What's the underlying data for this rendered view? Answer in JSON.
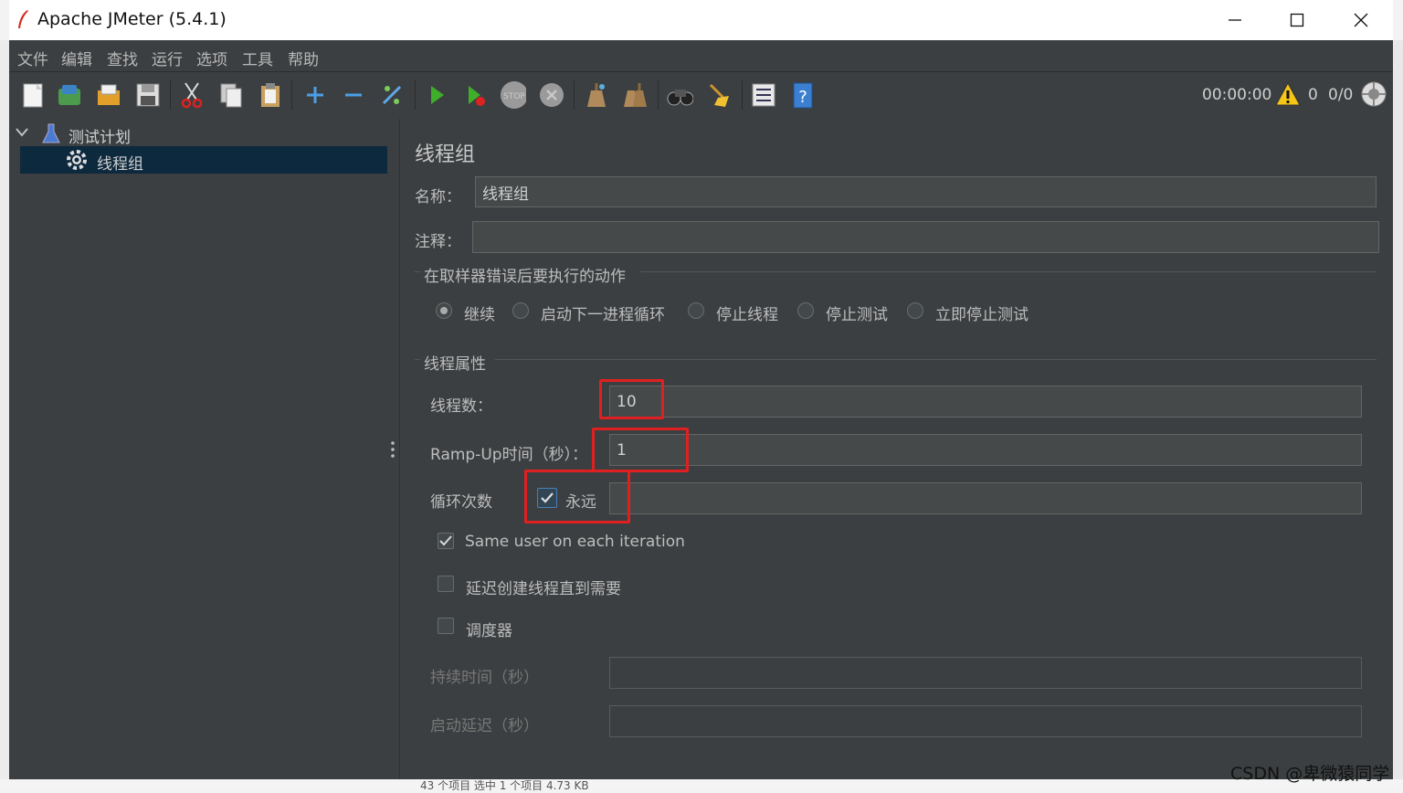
{
  "window": {
    "title": "Apache JMeter (5.4.1)"
  },
  "menu": [
    "文件",
    "编辑",
    "查找",
    "运行",
    "选项",
    "工具",
    "帮助"
  ],
  "toolbar": {
    "icons": [
      "new-icon",
      "templates-icon",
      "open-icon",
      "save-icon",
      "cut-icon",
      "copy-icon",
      "paste-icon",
      "expand-icon",
      "collapse-icon",
      "toggle-icon",
      "start-icon",
      "start-no-pause-icon",
      "stop-icon",
      "shutdown-icon",
      "clear-icon",
      "clear-all-icon",
      "search-icon",
      "reset-search-icon",
      "function-helper-icon",
      "help-icon"
    ],
    "timer": "00:00:00",
    "warning_count": "0",
    "thread_count": "0/0"
  },
  "tree": {
    "root_label": "测试计划",
    "child_label": "线程组"
  },
  "panel": {
    "title": "线程组",
    "name_label": "名称：",
    "name_value": "线程组",
    "comment_label": "注释：",
    "comment_value": "",
    "error_group_title": "在取样器错误后要执行的动作",
    "error_options": [
      "继续",
      "启动下一进程循环",
      "停止线程",
      "停止测试",
      "立即停止测试"
    ],
    "error_selected": 0,
    "thread_group_title": "线程属性",
    "threads_label": "线程数：",
    "threads_value": "10",
    "rampup_label": "Ramp-Up时间（秒）：",
    "rampup_value": "1",
    "loop_label": "循环次数",
    "forever_label": "永远",
    "forever_checked": true,
    "loop_value": "",
    "same_user_label": "Same user on each iteration",
    "same_user_checked": true,
    "delay_create_label": "延迟创建线程直到需要",
    "delay_create_checked": false,
    "scheduler_label": "调度器",
    "scheduler_checked": false,
    "duration_label": "持续时间（秒）",
    "duration_value": "",
    "startup_delay_label": "启动延迟（秒）",
    "startup_delay_value": ""
  },
  "background": {
    "status_text": "43 个项目    选中 1 个项目  4.73 KB"
  },
  "watermark": "CSDN @卑微猿同学",
  "colors": {
    "app_bg": "#3c3f41",
    "selection": "#0d293e",
    "highlight": "#e02020"
  }
}
